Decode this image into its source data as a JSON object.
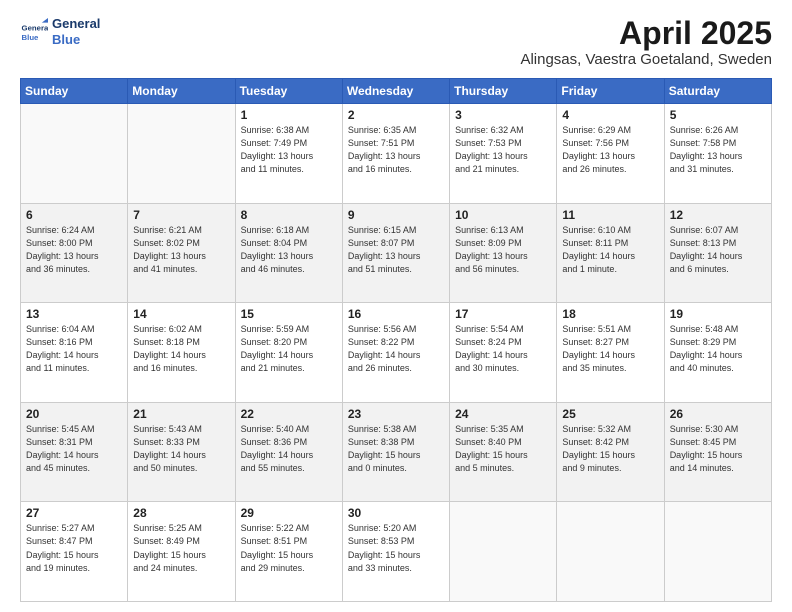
{
  "header": {
    "logo_line1": "General",
    "logo_line2": "Blue",
    "month": "April 2025",
    "location": "Alingsas, Vaestra Goetaland, Sweden"
  },
  "weekdays": [
    "Sunday",
    "Monday",
    "Tuesday",
    "Wednesday",
    "Thursday",
    "Friday",
    "Saturday"
  ],
  "weeks": [
    [
      {
        "day": "",
        "info": ""
      },
      {
        "day": "",
        "info": ""
      },
      {
        "day": "1",
        "info": "Sunrise: 6:38 AM\nSunset: 7:49 PM\nDaylight: 13 hours\nand 11 minutes."
      },
      {
        "day": "2",
        "info": "Sunrise: 6:35 AM\nSunset: 7:51 PM\nDaylight: 13 hours\nand 16 minutes."
      },
      {
        "day": "3",
        "info": "Sunrise: 6:32 AM\nSunset: 7:53 PM\nDaylight: 13 hours\nand 21 minutes."
      },
      {
        "day": "4",
        "info": "Sunrise: 6:29 AM\nSunset: 7:56 PM\nDaylight: 13 hours\nand 26 minutes."
      },
      {
        "day": "5",
        "info": "Sunrise: 6:26 AM\nSunset: 7:58 PM\nDaylight: 13 hours\nand 31 minutes."
      }
    ],
    [
      {
        "day": "6",
        "info": "Sunrise: 6:24 AM\nSunset: 8:00 PM\nDaylight: 13 hours\nand 36 minutes."
      },
      {
        "day": "7",
        "info": "Sunrise: 6:21 AM\nSunset: 8:02 PM\nDaylight: 13 hours\nand 41 minutes."
      },
      {
        "day": "8",
        "info": "Sunrise: 6:18 AM\nSunset: 8:04 PM\nDaylight: 13 hours\nand 46 minutes."
      },
      {
        "day": "9",
        "info": "Sunrise: 6:15 AM\nSunset: 8:07 PM\nDaylight: 13 hours\nand 51 minutes."
      },
      {
        "day": "10",
        "info": "Sunrise: 6:13 AM\nSunset: 8:09 PM\nDaylight: 13 hours\nand 56 minutes."
      },
      {
        "day": "11",
        "info": "Sunrise: 6:10 AM\nSunset: 8:11 PM\nDaylight: 14 hours\nand 1 minute."
      },
      {
        "day": "12",
        "info": "Sunrise: 6:07 AM\nSunset: 8:13 PM\nDaylight: 14 hours\nand 6 minutes."
      }
    ],
    [
      {
        "day": "13",
        "info": "Sunrise: 6:04 AM\nSunset: 8:16 PM\nDaylight: 14 hours\nand 11 minutes."
      },
      {
        "day": "14",
        "info": "Sunrise: 6:02 AM\nSunset: 8:18 PM\nDaylight: 14 hours\nand 16 minutes."
      },
      {
        "day": "15",
        "info": "Sunrise: 5:59 AM\nSunset: 8:20 PM\nDaylight: 14 hours\nand 21 minutes."
      },
      {
        "day": "16",
        "info": "Sunrise: 5:56 AM\nSunset: 8:22 PM\nDaylight: 14 hours\nand 26 minutes."
      },
      {
        "day": "17",
        "info": "Sunrise: 5:54 AM\nSunset: 8:24 PM\nDaylight: 14 hours\nand 30 minutes."
      },
      {
        "day": "18",
        "info": "Sunrise: 5:51 AM\nSunset: 8:27 PM\nDaylight: 14 hours\nand 35 minutes."
      },
      {
        "day": "19",
        "info": "Sunrise: 5:48 AM\nSunset: 8:29 PM\nDaylight: 14 hours\nand 40 minutes."
      }
    ],
    [
      {
        "day": "20",
        "info": "Sunrise: 5:45 AM\nSunset: 8:31 PM\nDaylight: 14 hours\nand 45 minutes."
      },
      {
        "day": "21",
        "info": "Sunrise: 5:43 AM\nSunset: 8:33 PM\nDaylight: 14 hours\nand 50 minutes."
      },
      {
        "day": "22",
        "info": "Sunrise: 5:40 AM\nSunset: 8:36 PM\nDaylight: 14 hours\nand 55 minutes."
      },
      {
        "day": "23",
        "info": "Sunrise: 5:38 AM\nSunset: 8:38 PM\nDaylight: 15 hours\nand 0 minutes."
      },
      {
        "day": "24",
        "info": "Sunrise: 5:35 AM\nSunset: 8:40 PM\nDaylight: 15 hours\nand 5 minutes."
      },
      {
        "day": "25",
        "info": "Sunrise: 5:32 AM\nSunset: 8:42 PM\nDaylight: 15 hours\nand 9 minutes."
      },
      {
        "day": "26",
        "info": "Sunrise: 5:30 AM\nSunset: 8:45 PM\nDaylight: 15 hours\nand 14 minutes."
      }
    ],
    [
      {
        "day": "27",
        "info": "Sunrise: 5:27 AM\nSunset: 8:47 PM\nDaylight: 15 hours\nand 19 minutes."
      },
      {
        "day": "28",
        "info": "Sunrise: 5:25 AM\nSunset: 8:49 PM\nDaylight: 15 hours\nand 24 minutes."
      },
      {
        "day": "29",
        "info": "Sunrise: 5:22 AM\nSunset: 8:51 PM\nDaylight: 15 hours\nand 29 minutes."
      },
      {
        "day": "30",
        "info": "Sunrise: 5:20 AM\nSunset: 8:53 PM\nDaylight: 15 hours\nand 33 minutes."
      },
      {
        "day": "",
        "info": ""
      },
      {
        "day": "",
        "info": ""
      },
      {
        "day": "",
        "info": ""
      }
    ]
  ]
}
